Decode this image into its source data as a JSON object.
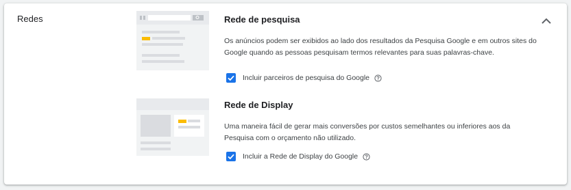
{
  "section": {
    "title": "Redes"
  },
  "search_network": {
    "title": "Rede de pesquisa",
    "description": "Os anúncios podem ser exibidos ao lado dos resultados da Pesquisa Google e em outros sites do Google quando as pessoas pesquisam termos relevantes para suas palavras-chave.",
    "checkbox_label": "Incluir parceiros de pesquisa do Google",
    "checked": true
  },
  "display_network": {
    "title": "Rede de Display",
    "description": "Uma maneira fácil de gerar mais conversões por custos semelhantes ou inferiores aos da Pesquisa com o orçamento não utilizado.",
    "checkbox_label": "Incluir a Rede de Display do Google",
    "checked": true
  },
  "icons": {
    "collapse": "chevron-up-icon",
    "help": "help-circle-icon",
    "check": "check-icon"
  },
  "colors": {
    "accent": "#1a73e8",
    "highlight": "#fbbc04",
    "illustration_gray": "#dadce0"
  }
}
